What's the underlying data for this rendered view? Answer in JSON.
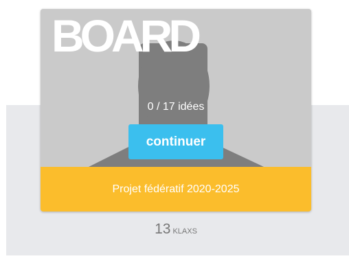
{
  "card": {
    "title_word": "BOARD",
    "ideas_progress": "0 / 17 idées",
    "continue_label": "continuer",
    "project_name": "Projet fédératif 2020-2025"
  },
  "klaxs": {
    "count": "13",
    "unit": "KLAXS"
  },
  "colors": {
    "accent_button": "#3bbfee",
    "project_bar": "#fbbd2c",
    "image_background": "#cacaca",
    "silhouette": "#7e7e7e",
    "page_panel": "#e8e9ec"
  },
  "icons": {
    "card_image": "person-silhouette-icon"
  }
}
